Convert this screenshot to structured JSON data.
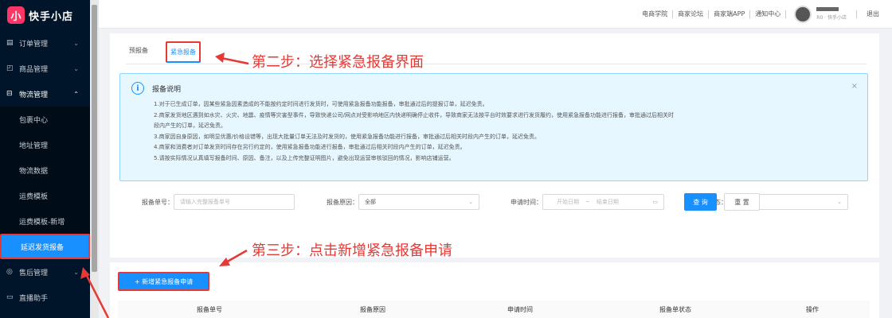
{
  "app": {
    "logo_glyph": "小",
    "name": "快手小店"
  },
  "sidebar": {
    "items": [
      {
        "label": "订单管理",
        "icon": "document-icon",
        "glyph": "▤"
      },
      {
        "label": "商品管理",
        "icon": "bag-icon",
        "glyph": "◰"
      },
      {
        "label": "物流管理",
        "icon": "truck-icon",
        "glyph": "⊟"
      },
      {
        "label": "售后管理",
        "icon": "shield-icon",
        "glyph": "◎"
      },
      {
        "label": "直播助手",
        "icon": "video-icon",
        "glyph": "▭"
      }
    ],
    "sub_items": [
      "包裹中心",
      "地址管理",
      "物流数据",
      "运费模板",
      "运费模板-新增",
      "延迟发货报备"
    ]
  },
  "header": {
    "links": [
      "电商学院",
      "商家论坛",
      "商家端APP",
      "通知中心"
    ],
    "user_sub": "R0 · 快手小店",
    "logout": "退出"
  },
  "tabs": [
    "预报备",
    "紧急报备"
  ],
  "notice": {
    "icon": "i",
    "title": "报备说明",
    "close": "×",
    "lines": [
      "1.对于已生成订单，因某些紧急因素造成的不能按约定时间进行发货时，可使用紧急报备功能报备，审批通过后的提报订单，延迟免责。",
      "2.商家发货地区遇到如水灾、火灾、地震、疫情等灾害型事件，导致快递公司/网点对受影响地区内快递明确停止收件，导致商家无法按平台时效要求进行发货履约，使用紧急报备功能进行报备，审批通过后相关时",
      "段内产生的订单，延迟免责。",
      "3.商家因自身原因，如明显优惠/价格设错等，出现大批量订单无法及时发货的，使用紧急报备功能进行报备，审批通过后相关时段内产生的订单，延迟免责。",
      "4.商家和消费者对订单发货时间存在另行约定的，使用紧急报备功能进行报备，审批通过后相关时段内产生的订单，延迟免责。",
      "5.请按实际情况认真填写报备时间、原因、备注，以及上传完整证明图片，避免出现运营审核驳回的情况，影响店铺运营。"
    ]
  },
  "filters": {
    "order_label": "报备单号：",
    "order_placeholder": "请输入完整报备单号",
    "reason_label": "报备原因：",
    "reason_value": "全部",
    "time_label": "申请时间：",
    "start_placeholder": "开始日期",
    "range_sep": "~",
    "end_placeholder": "结束日期",
    "status_label": "报备单状态：",
    "status_value": "全部"
  },
  "buttons": {
    "query": "查 询",
    "reset": "重 置",
    "add": "+ 新增紧急报备申请"
  },
  "table": {
    "columns": [
      "报备单号",
      "报备原因",
      "申请时间",
      "报备单状态",
      "操作"
    ]
  },
  "annotations": {
    "step2": "第二步：选择紧急报备界面",
    "step3": "第三步：点击新增紧急报备申请"
  },
  "colors": {
    "accent": "#1890ff",
    "sidebar_bg": "#001529",
    "annotation": "#e53935",
    "brand": "#fe3666"
  }
}
